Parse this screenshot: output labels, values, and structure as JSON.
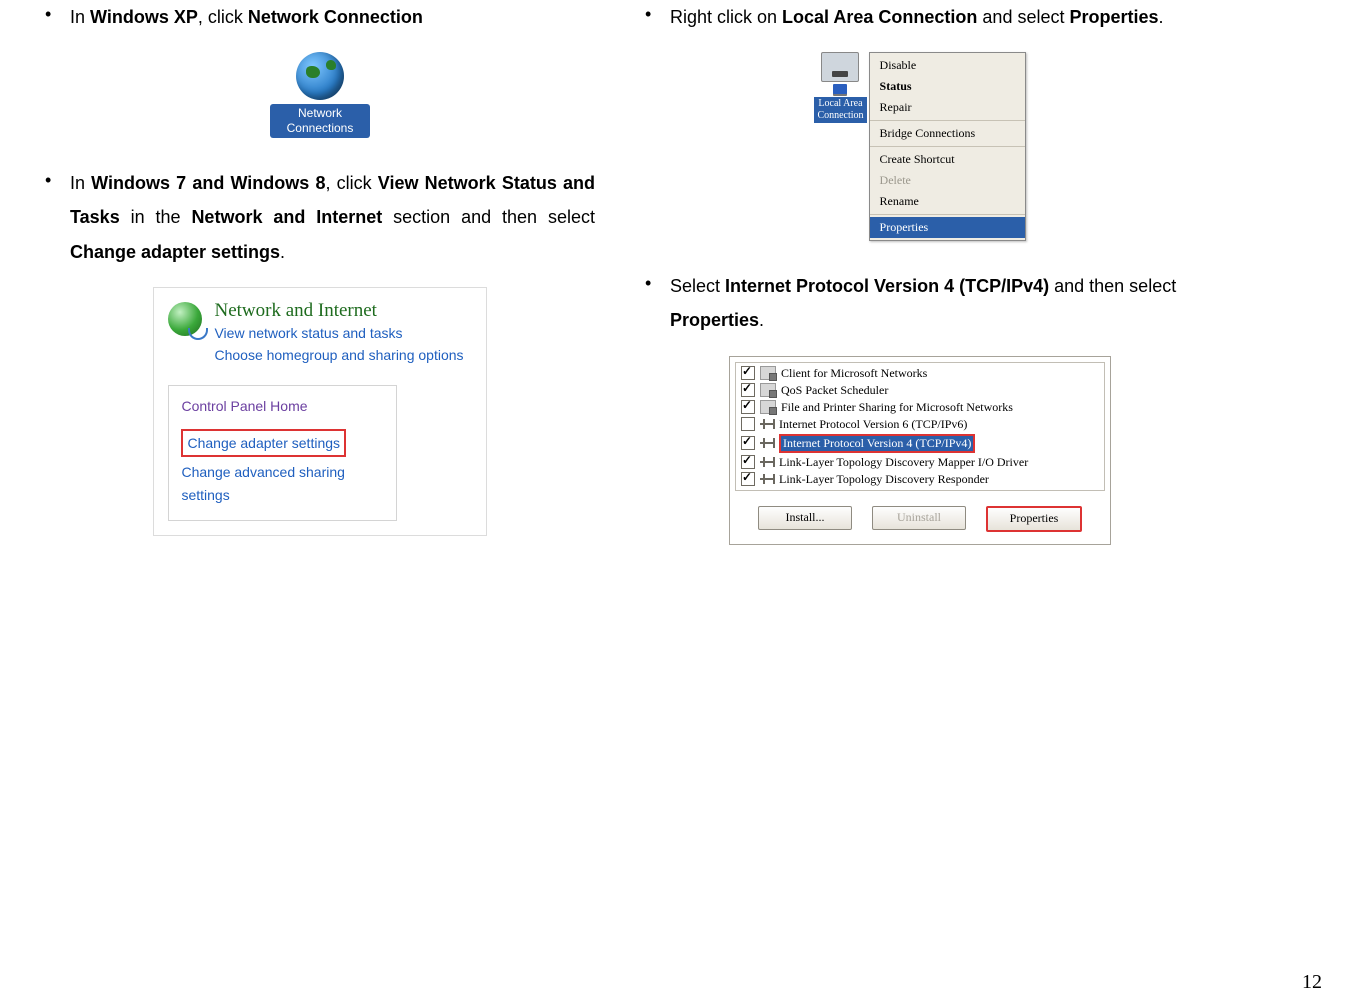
{
  "page_number": "12",
  "left": {
    "b1_pre": "In ",
    "b1_os": "Windows XP",
    "b1_mid": ", click ",
    "b1_action": "Network Connection",
    "ncicon_l1": "Network",
    "ncicon_l2": "Connections",
    "b2_pre": "In ",
    "b2_os": "Windows 7 and Windows 8",
    "b2_mid": ", click ",
    "b2_a1": "View Network Status and Tasks",
    "b2_mid2": " in the ",
    "b2_a2": "Network and Internet",
    "b2_mid3": " section and then select ",
    "b2_a3": "Change adapter settings",
    "b2_end": ".",
    "ni_head": "Network and Internet",
    "ni_sub1": "View network status and tasks",
    "ni_sub2": "Choose homegroup and sharing options",
    "ni_cphome": "Control Panel Home",
    "ni_cas": "Change adapter settings",
    "ni_adv1": "Change advanced sharing",
    "ni_adv2": "settings"
  },
  "right": {
    "b1_pre": "Right click on ",
    "b1_item": "Local Area Connection",
    "b1_mid": " and select ",
    "b1_prop": "Properties",
    "b1_end": ".",
    "lac_l1": "Local Area",
    "lac_l2": "Connection",
    "menu": {
      "disable": "Disable",
      "status": "Status",
      "repair": "Repair",
      "bridge": "Bridge Connections",
      "shortcut": "Create Shortcut",
      "delete": "Delete",
      "rename": "Rename",
      "properties": "Properties"
    },
    "b2_pre": "Select ",
    "b2_item": "Internet Protocol Version 4 (TCP/IPv4)",
    "b2_mid": " and then select ",
    "b2_prop": "Properties",
    "b2_end": ".",
    "list": {
      "i1": "Client for Microsoft Networks",
      "i2": "QoS Packet Scheduler",
      "i3": "File and Printer Sharing for Microsoft Networks",
      "i4": "Internet Protocol Version 6 (TCP/IPv6)",
      "i5": "Internet Protocol Version 4 (TCP/IPv4)",
      "i6": "Link-Layer Topology Discovery Mapper I/O Driver",
      "i7": "Link-Layer Topology Discovery Responder",
      "install": "Install...",
      "uninstall": "Uninstall",
      "properties": "Properties"
    }
  }
}
